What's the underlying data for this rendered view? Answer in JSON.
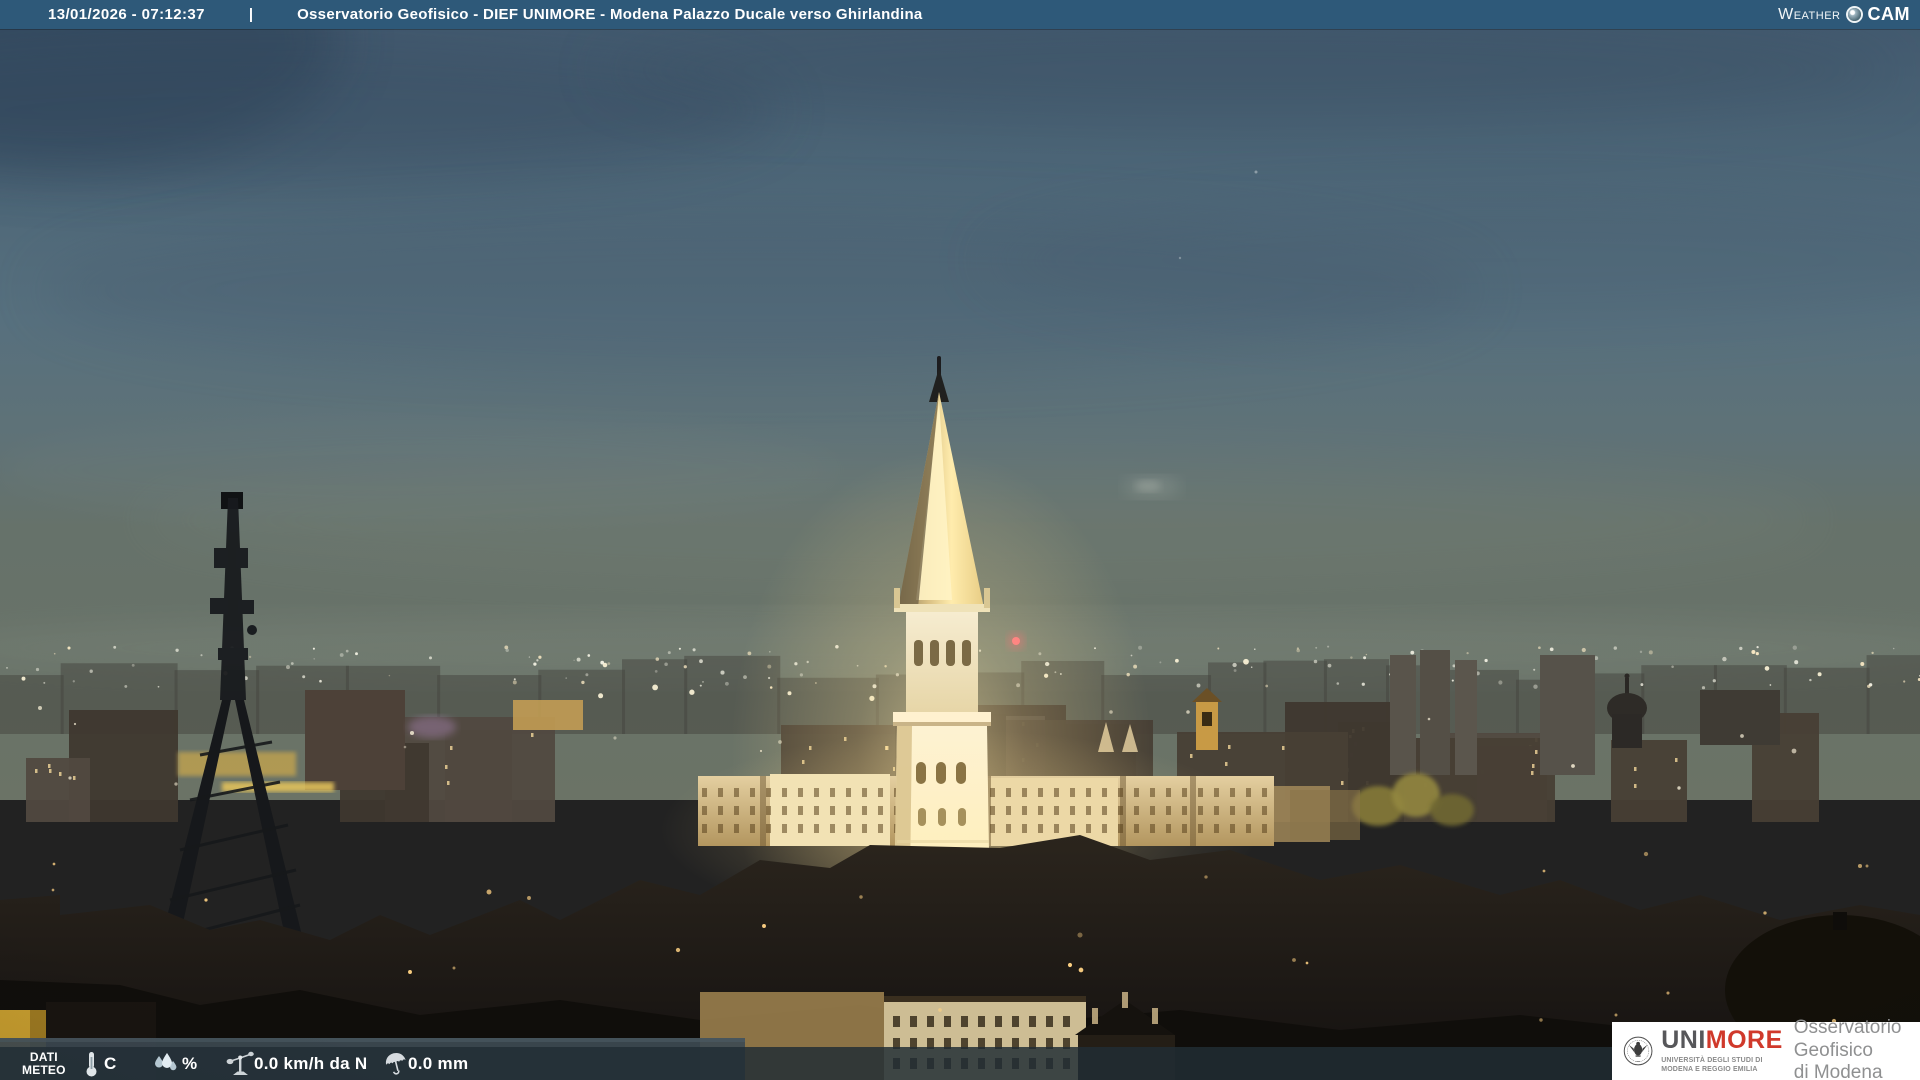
{
  "colors": {
    "top_bar": "#2e5979",
    "overlay_bar": "rgba(33,45,53,0.84)",
    "unimore_red": "#d0392b",
    "gray_text": "#8f9091",
    "tower_glow": "#ffe9ad"
  },
  "header": {
    "datetime": "13/01/2026 - 07:12:37",
    "separator": "|",
    "title": "Osservatorio Geofisico - DIEF UNIMORE - Modena Palazzo Ducale verso Ghirlandina",
    "logo": {
      "weather": "Weather",
      "cam": "CAM"
    }
  },
  "weather_bar": {
    "label_line1": "DATI",
    "label_line2": "METEO",
    "temperature_unit": "C",
    "humidity_unit": "%",
    "wind_value": "0.0 km/h da N",
    "rain_value": "0.0 mm",
    "icons": {
      "temperature": "thermometer-icon",
      "humidity": "droplets-icon",
      "wind": "anemometer-icon",
      "rain": "umbrella-icon"
    }
  },
  "branding": {
    "uni": "UNI",
    "more": "MORE",
    "university_line1": "UNIVERSITÀ DEGLI STUDI DI",
    "university_line2": "MODENA E REGGIO EMILIA",
    "org_line1": "Osservatorio Geofisico",
    "org_line2": "di Modena"
  }
}
